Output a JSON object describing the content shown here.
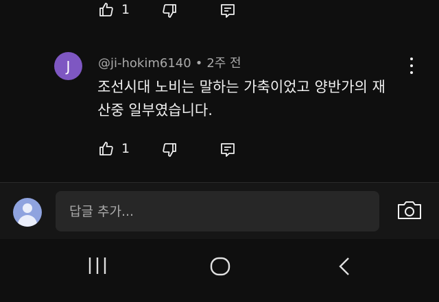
{
  "top_actions": {
    "like_count": "1"
  },
  "comment": {
    "avatar_letter": "J",
    "author": "@ji-hokim6140",
    "separator": "•",
    "time": "2주 전",
    "text": "조선시대 노비는 말하는 가축이었고 양반가의 재산중 일부였습니다.",
    "like_count": "1"
  },
  "composer": {
    "placeholder": "답글 추가..."
  },
  "icons": {
    "like": "thumbs-up-icon",
    "dislike": "thumbs-down-icon",
    "reply": "reply-icon",
    "more": "more-vert-icon",
    "camera": "camera-icon",
    "nav_recents": "recents-icon",
    "nav_home": "home-icon",
    "nav_back": "back-icon"
  },
  "colors": {
    "background": "#0f0f0f",
    "avatar": "#7e57c2",
    "input": "#272727"
  }
}
